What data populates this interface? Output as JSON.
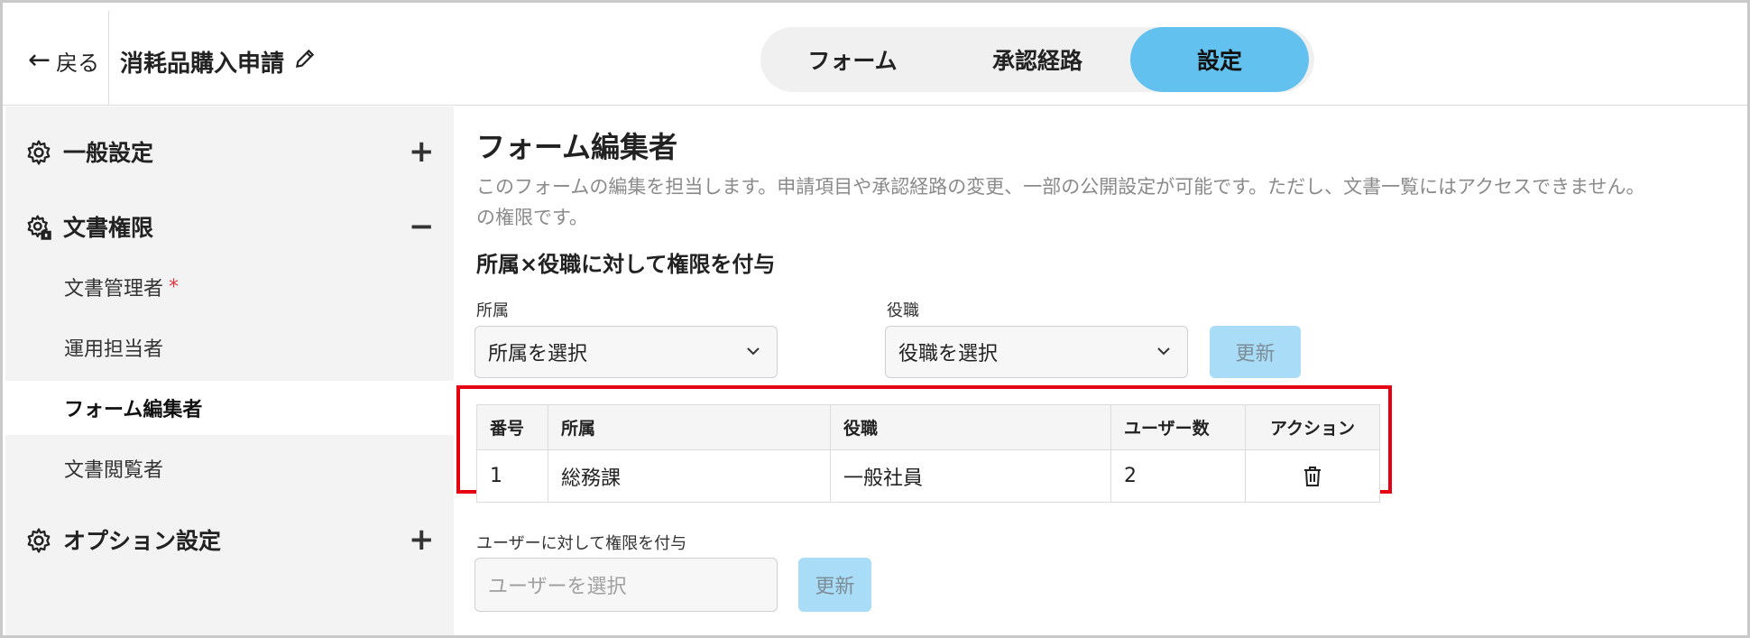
{
  "header": {
    "back_label": "戻る",
    "form_title": "消耗品購入申請",
    "tabs": [
      {
        "label": "フォーム"
      },
      {
        "label": "承認経路"
      },
      {
        "label": "設定"
      }
    ],
    "active_tab": "設定"
  },
  "sidebar": {
    "groups": [
      {
        "label": "一般設定",
        "toggle": "+",
        "icon": "gear-icon"
      },
      {
        "label": "文書権限",
        "toggle": "−",
        "icon": "gear-lock-icon"
      },
      {
        "label": "オプション設定",
        "toggle": "+",
        "icon": "gear-icon"
      }
    ],
    "items": [
      {
        "label": "文書管理者",
        "required": "*"
      },
      {
        "label": "運用担当者"
      },
      {
        "label": "フォーム編集者"
      },
      {
        "label": "文書閲覧者"
      }
    ],
    "active_item": "フォーム編集者"
  },
  "main": {
    "title": "フォーム編集者",
    "description_line1": "このフォームの編集を担当します。申請項目や承認経路の変更、一部の公開設定が可能です。ただし、文書一覧にはアクセスできません。",
    "description_line2": "の権限です。",
    "org_role_section": {
      "title": "所属×役職に対して権限を付与",
      "affiliation_label": "所属",
      "affiliation_value": "所属を選択",
      "role_label": "役職",
      "role_value": "役職を選択",
      "update_label": "更新"
    },
    "table": {
      "headers": [
        "番号",
        "所属",
        "役職",
        "ユーザー数",
        "アクション"
      ],
      "rows": [
        {
          "no": "1",
          "affiliation": "総務課",
          "role": "一般社員",
          "users": "2"
        }
      ]
    },
    "user_section": {
      "title": "ユーザーに対して権限を付与",
      "placeholder": "ユーザーを選択",
      "update_label": "更新"
    }
  },
  "colors": {
    "active_tab": "#62c1ef",
    "update_button": "#a9dcf6",
    "highlight": "#e50012",
    "required": "#e0383e"
  }
}
